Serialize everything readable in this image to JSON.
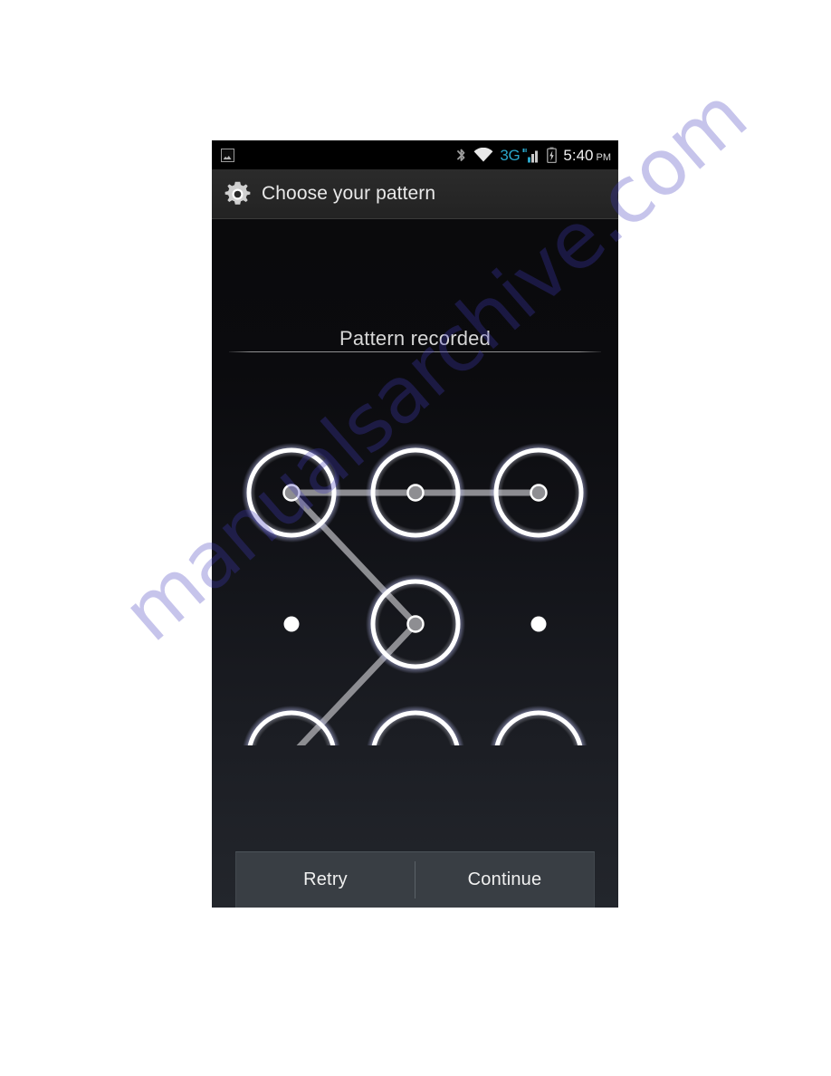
{
  "statusbar": {
    "left_icon": "picture-icon",
    "icons": [
      "bluetooth-icon",
      "wifi-icon",
      "signal-bars-icon",
      "battery-icon"
    ],
    "network_label": "3G",
    "network_color": "#2aa5c8",
    "time": "5:40",
    "ampm": "PM"
  },
  "actionbar": {
    "icon": "gear-icon",
    "title": "Choose your pattern"
  },
  "content": {
    "headline": "Pattern recorded"
  },
  "pattern": {
    "rows": 3,
    "cols": 3,
    "nodes": [
      {
        "id": "top-left",
        "row": 0,
        "col": 0,
        "selected": true
      },
      {
        "id": "top-center",
        "row": 0,
        "col": 1,
        "selected": true
      },
      {
        "id": "top-right",
        "row": 0,
        "col": 2,
        "selected": true
      },
      {
        "id": "middle-left",
        "row": 1,
        "col": 0,
        "selected": false
      },
      {
        "id": "middle-center",
        "row": 1,
        "col": 1,
        "selected": true
      },
      {
        "id": "middle-right",
        "row": 1,
        "col": 2,
        "selected": false
      },
      {
        "id": "bottom-left",
        "row": 2,
        "col": 0,
        "selected": true
      },
      {
        "id": "bottom-center",
        "row": 2,
        "col": 1,
        "selected": true
      },
      {
        "id": "bottom-right",
        "row": 2,
        "col": 2,
        "selected": true
      }
    ],
    "path": [
      "top-right",
      "top-center",
      "top-left",
      "middle-center",
      "bottom-left",
      "bottom-center",
      "bottom-right"
    ],
    "line_color": "#9a9a9e",
    "ring_color": "#ffffff"
  },
  "buttons": {
    "retry_label": "Retry",
    "continue_label": "Continue"
  },
  "watermark": {
    "text": "manualsarchive.com",
    "color": "#423cbe"
  }
}
